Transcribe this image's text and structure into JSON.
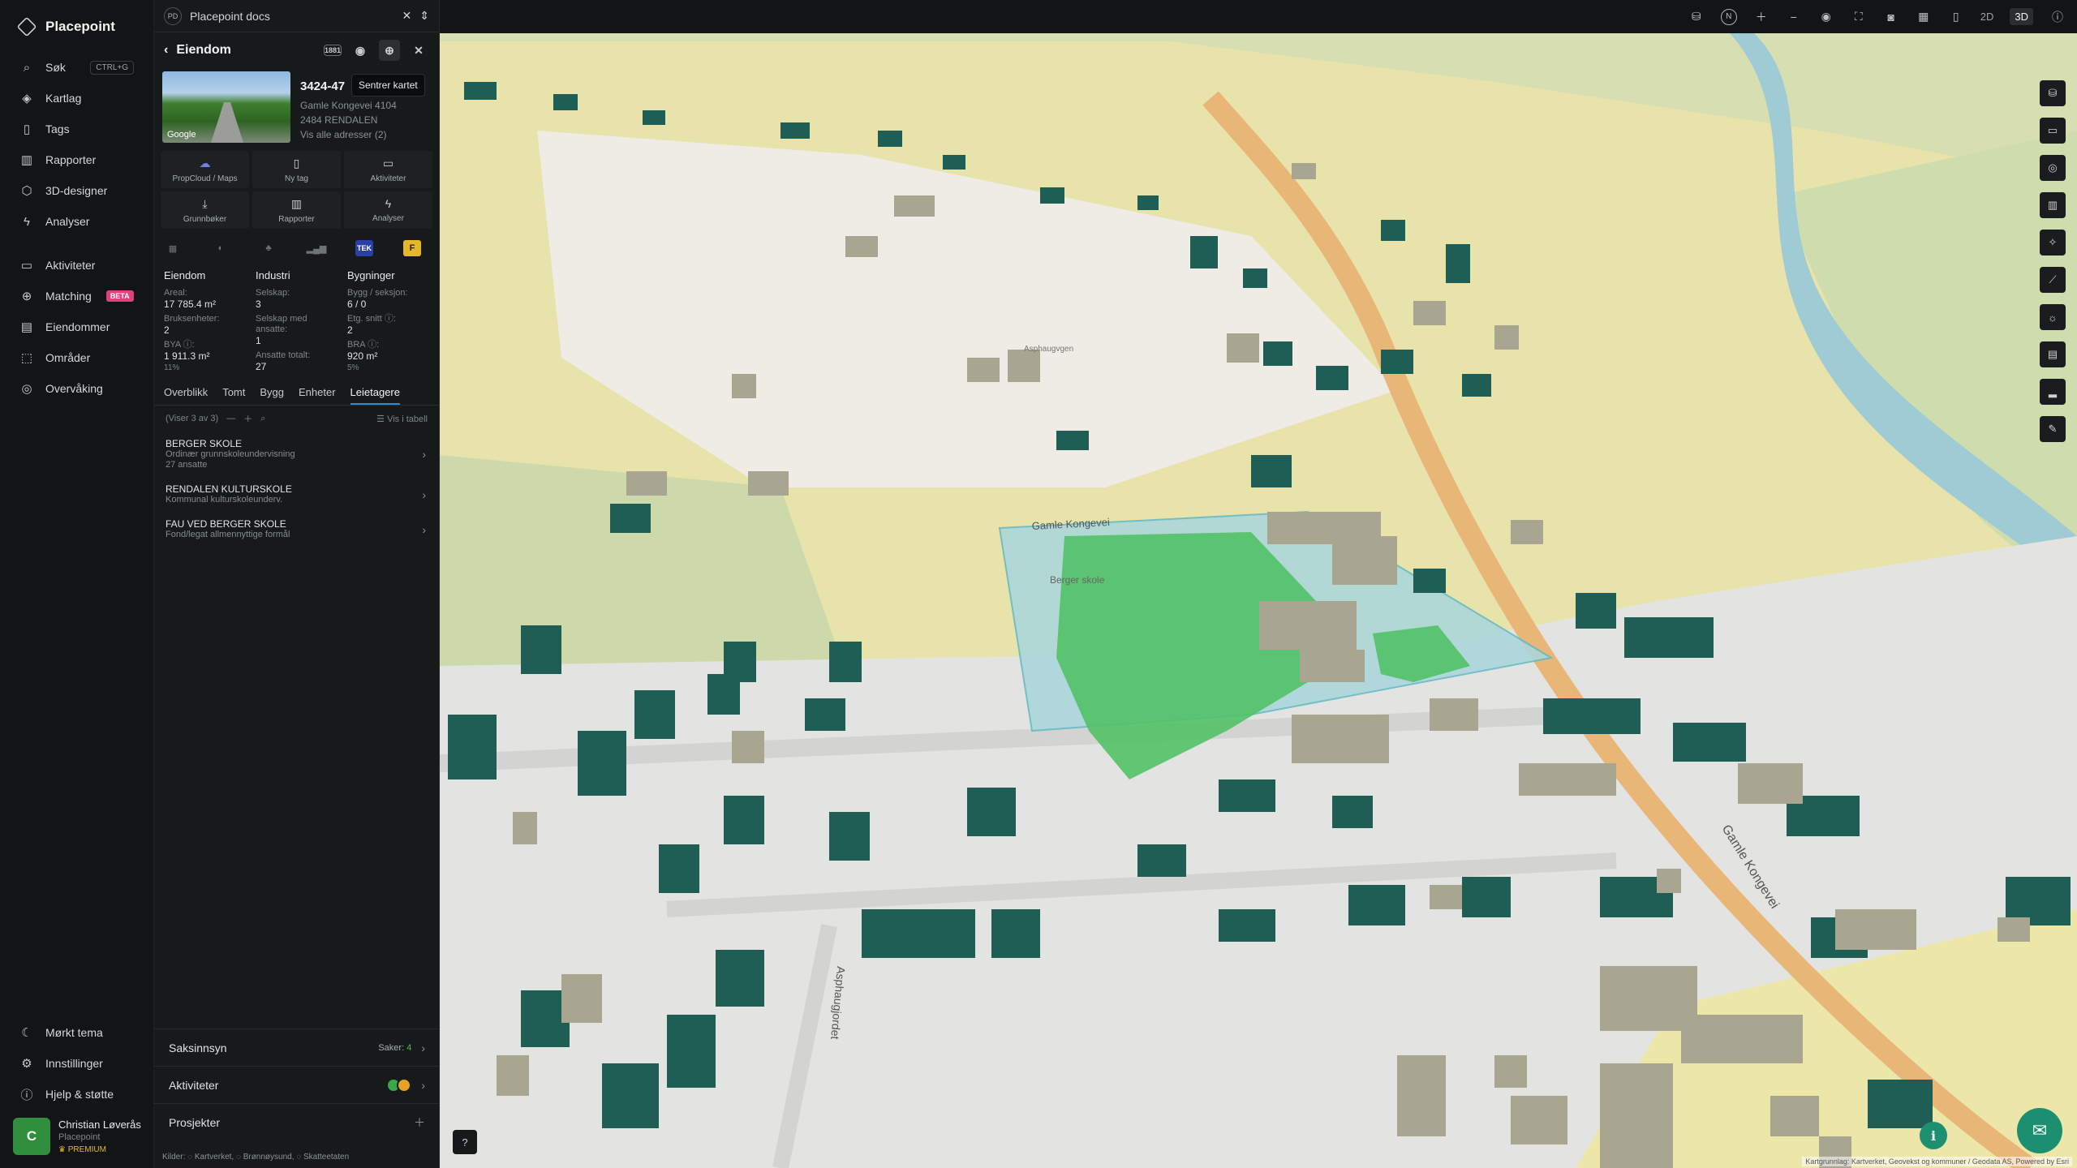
{
  "app": {
    "name": "Placepoint"
  },
  "nav": {
    "primary": [
      {
        "label": "Søk",
        "icon": "search-icon",
        "kbd": "CTRL+G"
      },
      {
        "label": "Kartlag",
        "icon": "layers-icon"
      },
      {
        "label": "Tags",
        "icon": "bookmark-icon"
      },
      {
        "label": "Rapporter",
        "icon": "chart-icon"
      },
      {
        "label": "3D-designer",
        "icon": "cube-icon"
      },
      {
        "label": "Analyser",
        "icon": "bolt-icon"
      }
    ],
    "secondary": [
      {
        "label": "Aktiviteter",
        "icon": "chat-icon"
      },
      {
        "label": "Matching",
        "icon": "match-icon",
        "badge": "BETA"
      },
      {
        "label": "Eiendommer",
        "icon": "building-icon"
      },
      {
        "label": "Områder",
        "icon": "area-icon"
      },
      {
        "label": "Overvåking",
        "icon": "monitor-icon"
      }
    ],
    "bottom": [
      {
        "label": "Mørkt tema",
        "icon": "moon-icon"
      },
      {
        "label": "Innstillinger",
        "icon": "gear-icon"
      },
      {
        "label": "Hjelp & støtte",
        "icon": "help-icon"
      }
    ],
    "user": {
      "initial": "C",
      "name": "Christian Løverås",
      "org": "Placepoint",
      "tier": "PREMIUM"
    }
  },
  "docbar": {
    "badge": "PD",
    "title": "Placepoint docs"
  },
  "panel": {
    "title": "Eiendom",
    "tooltip": "Sentrer kartet",
    "photo_label": "Google",
    "property": {
      "id": "3424-47",
      "address": "Gamle Kongevei 4104",
      "postal": "2484 RENDALEN",
      "more": "Vis alle adresser (2)"
    },
    "actions": [
      {
        "label": "PropCloud / Maps",
        "icon": "cloud-icon"
      },
      {
        "label": "Ny tag",
        "icon": "bookmark-icon"
      },
      {
        "label": "Aktiviteter",
        "icon": "chat-icon"
      },
      {
        "label": "Grunnbøker",
        "icon": "download-icon"
      },
      {
        "label": "Rapporter",
        "icon": "chart-icon"
      },
      {
        "label": "Analyser",
        "icon": "bolt-icon"
      }
    ],
    "source_icons": [
      "1881",
      "globe",
      "farm",
      "bars",
      "TEK",
      "F"
    ],
    "stats": {
      "col1": {
        "header": "Eiendom",
        "areal_label": "Areal:",
        "areal_value": "17 785.4 m²",
        "bruks_label": "Bruksenheter:",
        "bruks_value": "2",
        "bya_label": "BYA ⓘ:",
        "bya_value": "1 911.3 m²",
        "bya_pct": "11%"
      },
      "col2": {
        "header": "Industri",
        "selskap_label": "Selskap:",
        "selskap_value": "3",
        "ansatte_label": "Selskap med ansatte:",
        "ansatte_value": "1",
        "total_label": "Ansatte totalt:",
        "total_value": "27"
      },
      "col3": {
        "header": "Bygninger",
        "bygg_label": "Bygg / seksjon:",
        "bygg_value": "6 / 0",
        "etg_label": "Etg. snitt ⓘ:",
        "etg_value": "2",
        "bra_label": "BRA ⓘ:",
        "bra_value": "920 m²",
        "bra_pct": "5%"
      }
    },
    "tabs": [
      "Overblikk",
      "Tomt",
      "Bygg",
      "Enheter",
      "Leietagere"
    ],
    "list_info": "(Viser 3 av 3)",
    "table_toggle": "Vis i tabell",
    "tenants": [
      {
        "name": "BERGER SKOLE",
        "desc": "Ordinær grunnskoleundervisning",
        "extra": "27 ansatte"
      },
      {
        "name": "RENDALEN KULTURSKOLE",
        "desc": "Kommunal kulturskoleunderv.",
        "extra": ""
      },
      {
        "name": "FAU VED BERGER SKOLE",
        "desc": "Fond/legat allmennyttige formål",
        "extra": ""
      }
    ],
    "sections": {
      "saksinnsyn": "Saksinnsyn",
      "saker_label": "Saker:",
      "saker_count": "4",
      "aktiviteter": "Aktiviteter",
      "prosjekter": "Prosjekter"
    },
    "sources": "Kilder: ◌ Kartverket, ◌ Brønnøysund, ◌ Skatteetaten"
  },
  "topbar": {
    "north": "N",
    "mode_2d": "2D",
    "mode_3d": "3D"
  },
  "map": {
    "labels": {
      "road_a": "Gamle Kongevei",
      "road_b": "Gamle Kongevei",
      "school": "Berger skole",
      "road_c": "Asphaugvgen",
      "road_d": "Asphaugjordet"
    },
    "attribution": "Kartgrunnlag: Kartverket, Geovekst og kommuner / Geodata AS, Powered by Esri"
  },
  "colors": {
    "accent": "#2f8ad1",
    "building": "#1f5e55",
    "farmland": "#e9e3a6",
    "grass": "#cfdcae",
    "plot": "#9ecfd6",
    "green": "#4cc45e",
    "river": "#8fc3cf",
    "road": "#e8b778"
  }
}
